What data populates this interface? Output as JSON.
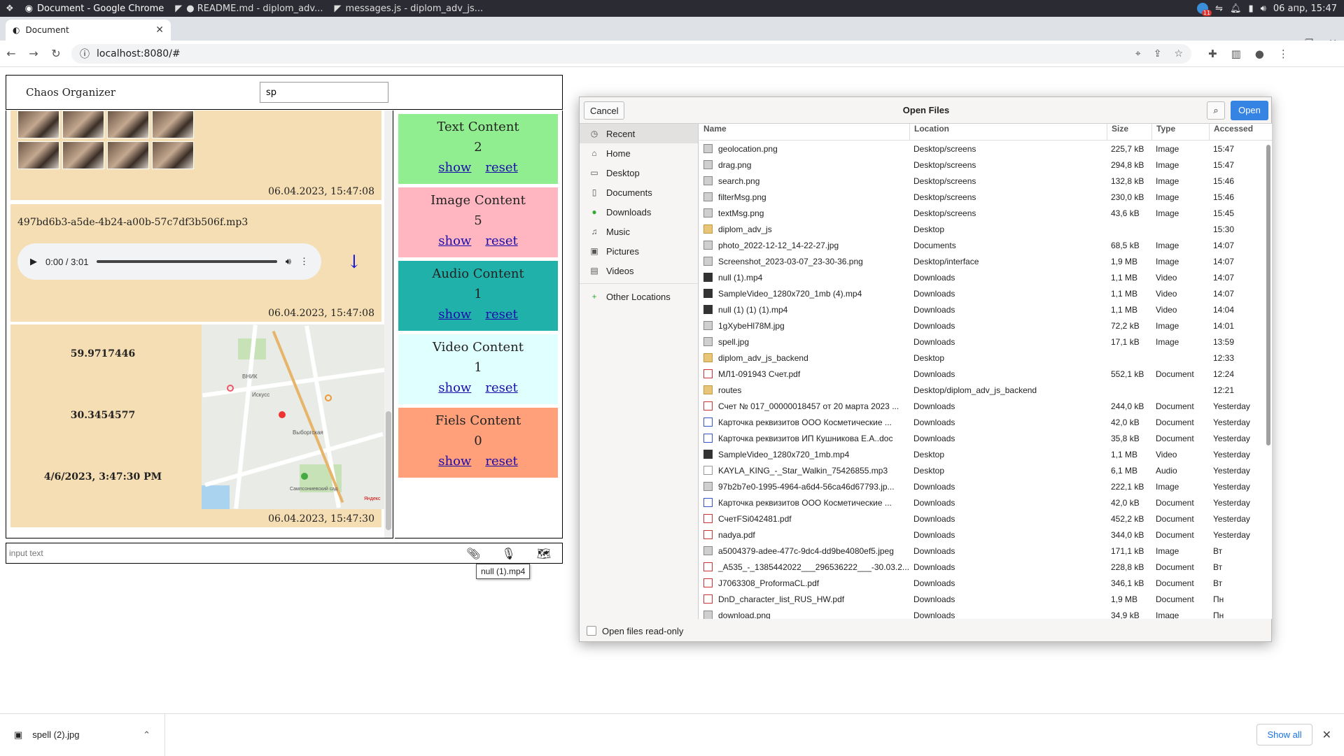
{
  "os": {
    "tasks": [
      "Document - Google Chrome",
      "● README.md - diplom_adv...",
      "messages.js - diplom_adv_js..."
    ],
    "badge_count": "11",
    "clock": "06 апр, 15:47"
  },
  "browser": {
    "tab_title": "Document",
    "url": "localhost:8080/#"
  },
  "app": {
    "title": "Chaos Organizer",
    "search_value": "sp",
    "messages": {
      "images_stamp": "06.04.2023, 15:47:08",
      "audio_name": "497bd6b3-a5de-4b24-a00b-57c7df3b506f.mp3",
      "audio_time": "0:00 / 3:01",
      "audio_stamp": "06.04.2023, 15:47:08",
      "geo_lat": "59.9717446",
      "geo_lon": "30.3454577",
      "geo_date": "4/6/2023, 3:47:30 PM",
      "geo_stamp": "06.04.2023, 15:47:30",
      "map_labels": [
        "ВНИК",
        "Искусс",
        "Выборгская",
        "Сампсониевский сад",
        "Яндекс"
      ]
    },
    "cards": [
      {
        "title": "Text Content",
        "count": "2",
        "show": "show",
        "reset": "reset",
        "color": "#90ee90"
      },
      {
        "title": "Image Content",
        "count": "5",
        "show": "show",
        "reset": "reset",
        "color": "#ffb6c1"
      },
      {
        "title": "Audio Content",
        "count": "1",
        "show": "show",
        "reset": "reset",
        "color": "#20b2aa"
      },
      {
        "title": "Video Content",
        "count": "1",
        "show": "show",
        "reset": "reset",
        "color": "#e0ffff"
      },
      {
        "title": "Fiels Content",
        "count": "0",
        "show": "show",
        "reset": "reset",
        "color": "#ffa07a"
      }
    ],
    "input_placeholder": "input text",
    "tooltip": "null (1).mp4"
  },
  "dialog": {
    "title": "Open Files",
    "cancel": "Cancel",
    "open": "Open",
    "columns": [
      "Name",
      "Location",
      "Size",
      "Type",
      "Accessed"
    ],
    "places": [
      "Recent",
      "Home",
      "Desktop",
      "Documents",
      "Downloads",
      "Music",
      "Pictures",
      "Videos",
      "Other Locations"
    ],
    "readonly_label": "Open files read-only",
    "files": [
      {
        "name": "geolocation.png",
        "loc": "Desktop/screens",
        "size": "225,7 kB",
        "type": "Image",
        "acc": "15:47",
        "icon": "img"
      },
      {
        "name": "drag.png",
        "loc": "Desktop/screens",
        "size": "294,8 kB",
        "type": "Image",
        "acc": "15:47",
        "icon": "img"
      },
      {
        "name": "search.png",
        "loc": "Desktop/screens",
        "size": "132,8 kB",
        "type": "Image",
        "acc": "15:46",
        "icon": "img"
      },
      {
        "name": "filterMsg.png",
        "loc": "Desktop/screens",
        "size": "230,0 kB",
        "type": "Image",
        "acc": "15:46",
        "icon": "img"
      },
      {
        "name": "textMsg.png",
        "loc": "Desktop/screens",
        "size": "43,6 kB",
        "type": "Image",
        "acc": "15:45",
        "icon": "img"
      },
      {
        "name": "diplom_adv_js",
        "loc": "Desktop",
        "size": "",
        "type": "",
        "acc": "15:30",
        "icon": "folder"
      },
      {
        "name": "photo_2022-12-12_14-22-27.jpg",
        "loc": "Documents",
        "size": "68,5 kB",
        "type": "Image",
        "acc": "14:07",
        "icon": "img"
      },
      {
        "name": "Screenshot_2023-03-07_23-30-36.png",
        "loc": "Desktop/interface",
        "size": "1,9 MB",
        "type": "Image",
        "acc": "14:07",
        "icon": "img"
      },
      {
        "name": "null (1).mp4",
        "loc": "Downloads",
        "size": "1,1 MB",
        "type": "Video",
        "acc": "14:07",
        "icon": "video"
      },
      {
        "name": "SampleVideo_1280x720_1mb (4).mp4",
        "loc": "Downloads",
        "size": "1,1 MB",
        "type": "Video",
        "acc": "14:07",
        "icon": "video"
      },
      {
        "name": "null (1) (1) (1).mp4",
        "loc": "Downloads",
        "size": "1,1 MB",
        "type": "Video",
        "acc": "14:04",
        "icon": "video"
      },
      {
        "name": "1gXybeHl78M.jpg",
        "loc": "Downloads",
        "size": "72,2 kB",
        "type": "Image",
        "acc": "14:01",
        "icon": "img"
      },
      {
        "name": "spell.jpg",
        "loc": "Downloads",
        "size": "17,1 kB",
        "type": "Image",
        "acc": "13:59",
        "icon": "img"
      },
      {
        "name": "diplom_adv_js_backend",
        "loc": "Desktop",
        "size": "",
        "type": "",
        "acc": "12:33",
        "icon": "folder"
      },
      {
        "name": "МЛ1-091943 Счет.pdf",
        "loc": "Downloads",
        "size": "552,1 kB",
        "type": "Document",
        "acc": "12:24",
        "icon": "pdf"
      },
      {
        "name": "routes",
        "loc": "Desktop/diplom_adv_js_backend",
        "size": "",
        "type": "",
        "acc": "12:21",
        "icon": "folder"
      },
      {
        "name": "Счет № 017_00000018457 от 20 марта 2023 ...",
        "loc": "Downloads",
        "size": "244,0 kB",
        "type": "Document",
        "acc": "Yesterday",
        "icon": "pdf"
      },
      {
        "name": "Карточка реквизитов ООО Косметические ...",
        "loc": "Downloads",
        "size": "42,0 kB",
        "type": "Document",
        "acc": "Yesterday",
        "icon": "doc"
      },
      {
        "name": "Карточка реквизитов ИП Кушникова Е.А..doc",
        "loc": "Downloads",
        "size": "35,8 kB",
        "type": "Document",
        "acc": "Yesterday",
        "icon": "doc"
      },
      {
        "name": "SampleVideo_1280x720_1mb.mp4",
        "loc": "Desktop",
        "size": "1,1 MB",
        "type": "Video",
        "acc": "Yesterday",
        "icon": "video"
      },
      {
        "name": "KAYLA_KING_-_Star_Walkin_75426855.mp3",
        "loc": "Desktop",
        "size": "6,1 MB",
        "type": "Audio",
        "acc": "Yesterday",
        "icon": "audio"
      },
      {
        "name": "97b2b7e0-1995-4964-a6d4-56ca46d67793.jp...",
        "loc": "Downloads",
        "size": "222,1 kB",
        "type": "Image",
        "acc": "Yesterday",
        "icon": "img"
      },
      {
        "name": "Карточка реквизитов ООО Косметические ...",
        "loc": "Downloads",
        "size": "42,0 kB",
        "type": "Document",
        "acc": "Yesterday",
        "icon": "doc"
      },
      {
        "name": "СчетFSi042481.pdf",
        "loc": "Downloads",
        "size": "452,2 kB",
        "type": "Document",
        "acc": "Yesterday",
        "icon": "pdf"
      },
      {
        "name": "nadya.pdf",
        "loc": "Downloads",
        "size": "344,0 kB",
        "type": "Document",
        "acc": "Yesterday",
        "icon": "pdf"
      },
      {
        "name": "a5004379-adee-477c-9dc4-dd9be4080ef5.jpeg",
        "loc": "Downloads",
        "size": "171,1 kB",
        "type": "Image",
        "acc": "Вт",
        "icon": "img"
      },
      {
        "name": "_A535_-_1385442022___296536222___-30.03.2...",
        "loc": "Downloads",
        "size": "228,8 kB",
        "type": "Document",
        "acc": "Вт",
        "icon": "pdf"
      },
      {
        "name": "J7063308_ProformaCL.pdf",
        "loc": "Downloads",
        "size": "346,1 kB",
        "type": "Document",
        "acc": "Вт",
        "icon": "pdf"
      },
      {
        "name": "DnD_character_list_RUS_HW.pdf",
        "loc": "Downloads",
        "size": "1,9 MB",
        "type": "Document",
        "acc": "Пн",
        "icon": "pdf"
      },
      {
        "name": "download.png",
        "loc": "Downloads",
        "size": "34,9 kB",
        "type": "Image",
        "acc": "Пн",
        "icon": "img"
      }
    ]
  },
  "downloads": {
    "item": "spell (2).jpg",
    "show_all": "Show all"
  }
}
